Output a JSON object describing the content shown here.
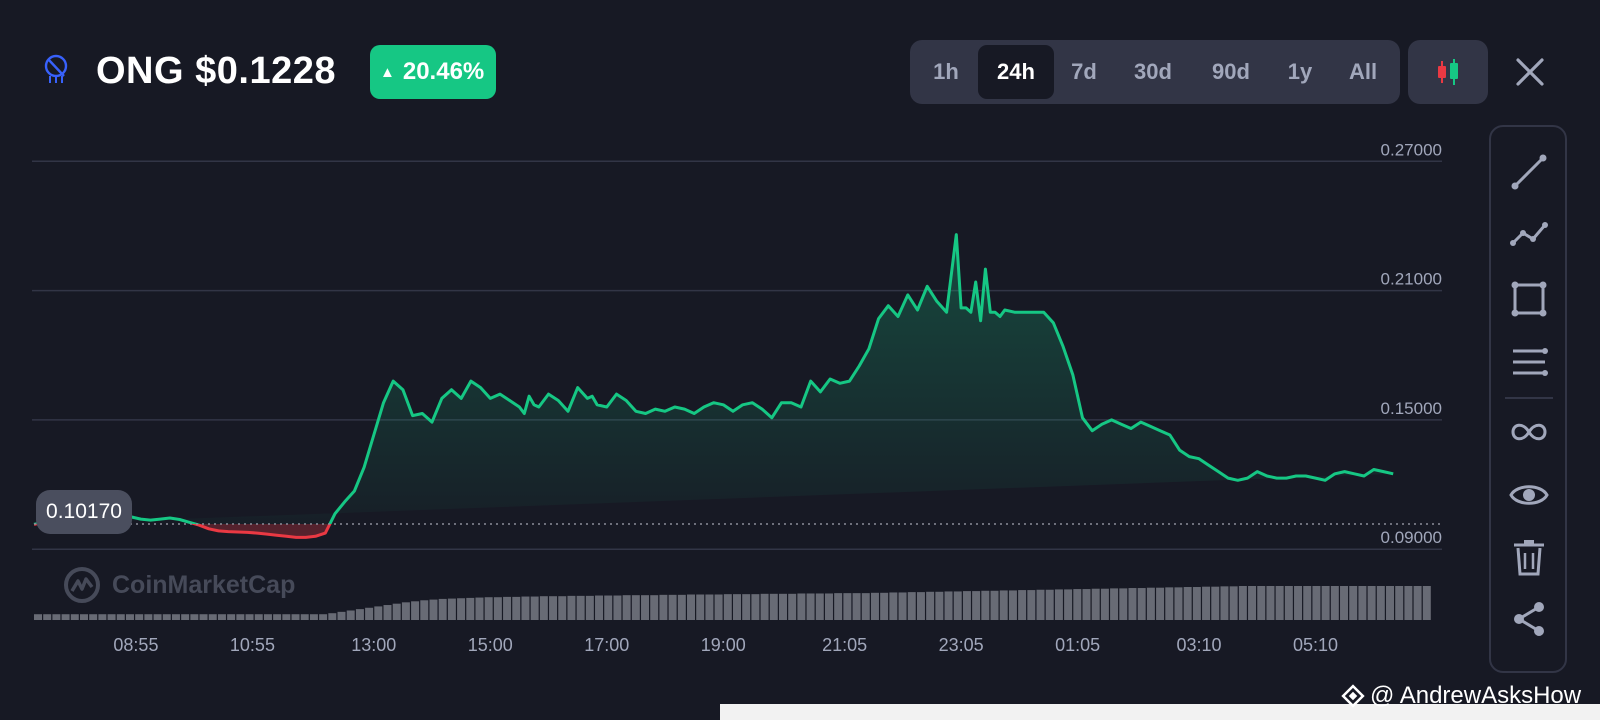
{
  "header": {
    "coin_symbol": "ONG",
    "price": "$0.1228",
    "change": "20.46%",
    "icon": "ontology-gas-icon"
  },
  "ranges": [
    {
      "label": "1h",
      "active": false
    },
    {
      "label": "24h",
      "active": true
    },
    {
      "label": "7d",
      "active": false
    },
    {
      "label": "30d",
      "active": false
    },
    {
      "label": "90d",
      "active": false
    },
    {
      "label": "1y",
      "active": false
    },
    {
      "label": "All",
      "active": false
    }
  ],
  "tools": [
    "line-tool-icon",
    "polyline-tool-icon",
    "rectangle-tool-icon",
    "horizontal-lines-tool-icon",
    "infinity-icon",
    "eye-icon",
    "trash-icon",
    "share-icon"
  ],
  "watermark": "CoinMarketCap",
  "credit": "@ AndrewAsksHow",
  "colors": {
    "up": "#16c784",
    "down": "#ea3943",
    "background": "#171924",
    "grid": "#323546",
    "axis_text": "#a1a7bb"
  },
  "chart_data": {
    "type": "line",
    "title": "",
    "xlabel": "",
    "ylabel": "",
    "reference_price": 0.1017,
    "reference_label": "0.10170",
    "ylim": [
      0.085,
      0.272
    ],
    "y_ticks": [
      0.27,
      0.21,
      0.15,
      0.09
    ],
    "y_tick_labels": [
      "0.27000",
      "0.21000",
      "0.15000",
      "0.09000"
    ],
    "x_tick_labels": [
      "08:55",
      "10:55",
      "13:00",
      "15:00",
      "17:00",
      "19:00",
      "21:05",
      "23:05",
      "01:05",
      "03:10",
      "05:10"
    ],
    "x_range_minutes": [
      0,
      1440
    ],
    "x_tick_minutes": [
      105,
      225,
      350,
      470,
      590,
      710,
      835,
      955,
      1075,
      1200,
      1320
    ],
    "grid": "horizontal",
    "series": [
      {
        "x_minutes": [
          0,
          10,
          20,
          30,
          40,
          50,
          60,
          70,
          80,
          90,
          100,
          110,
          120,
          130,
          140,
          150,
          160,
          170,
          180,
          190,
          200,
          210,
          220,
          230,
          240,
          250,
          260,
          270,
          280,
          290,
          300,
          310,
          320,
          330,
          340,
          350,
          360,
          370,
          380,
          390,
          400,
          410,
          420,
          430,
          440,
          450,
          460,
          470,
          480,
          490,
          500,
          505,
          510,
          515,
          520,
          530,
          540,
          550,
          560,
          570,
          575,
          580,
          590,
          600,
          610,
          620,
          630,
          640,
          650,
          660,
          670,
          680,
          690,
          700,
          710,
          720,
          730,
          740,
          750,
          760,
          770,
          780,
          790,
          800,
          810,
          820,
          830,
          840,
          850,
          860,
          870,
          880,
          890,
          900,
          910,
          920,
          930,
          940,
          950,
          955,
          960,
          965,
          970,
          975,
          980,
          985,
          990,
          995,
          1000,
          1010,
          1020,
          1030,
          1040,
          1050,
          1060,
          1070,
          1080,
          1090,
          1100,
          1110,
          1120,
          1130,
          1140,
          1150,
          1160,
          1170,
          1180,
          1190,
          1200,
          1210,
          1220,
          1230,
          1240,
          1250,
          1260,
          1270,
          1280,
          1290,
          1300,
          1310,
          1320,
          1330,
          1340,
          1350,
          1360,
          1370,
          1380,
          1390,
          1400,
          1410,
          1420,
          1430
        ],
        "values": [
          0.1015,
          0.1025,
          0.1035,
          0.103,
          0.1025,
          0.1022,
          0.1018,
          0.1015,
          0.103,
          0.1055,
          0.105,
          0.104,
          0.1035,
          0.104,
          0.1045,
          0.1038,
          0.1025,
          0.1012,
          0.0995,
          0.0985,
          0.0982,
          0.098,
          0.0978,
          0.0975,
          0.097,
          0.0965,
          0.096,
          0.0955,
          0.0955,
          0.096,
          0.0975,
          0.1065,
          0.112,
          0.117,
          0.128,
          0.143,
          0.158,
          0.168,
          0.164,
          0.152,
          0.153,
          0.149,
          0.16,
          0.164,
          0.16,
          0.168,
          0.165,
          0.16,
          0.162,
          0.159,
          0.156,
          0.153,
          0.161,
          0.157,
          0.156,
          0.162,
          0.159,
          0.154,
          0.165,
          0.16,
          0.161,
          0.157,
          0.156,
          0.162,
          0.159,
          0.154,
          0.153,
          0.155,
          0.154,
          0.156,
          0.155,
          0.153,
          0.156,
          0.158,
          0.157,
          0.154,
          0.157,
          0.158,
          0.155,
          0.151,
          0.158,
          0.158,
          0.156,
          0.168,
          0.163,
          0.169,
          0.167,
          0.168,
          0.175,
          0.183,
          0.197,
          0.203,
          0.198,
          0.208,
          0.201,
          0.212,
          0.205,
          0.2,
          0.236,
          0.202,
          0.202,
          0.2,
          0.214,
          0.196,
          0.22,
          0.2,
          0.2,
          0.198,
          0.201,
          0.2,
          0.2,
          0.2,
          0.2,
          0.195,
          0.184,
          0.171,
          0.151,
          0.145,
          0.148,
          0.15,
          0.148,
          0.146,
          0.149,
          0.147,
          0.145,
          0.143,
          0.136,
          0.133,
          0.132,
          0.129,
          0.126,
          0.123,
          0.122,
          0.123,
          0.126,
          0.124,
          0.123,
          0.123,
          0.124,
          0.124,
          0.123,
          0.122,
          0.125,
          0.126,
          0.125,
          0.124,
          0.127,
          0.126,
          0.125
        ],
        "volume": [
          0.17,
          0.17,
          0.17,
          0.17,
          0.17,
          0.17,
          0.17,
          0.17,
          0.17,
          0.17,
          0.17,
          0.17,
          0.17,
          0.17,
          0.17,
          0.17,
          0.17,
          0.17,
          0.17,
          0.17,
          0.17,
          0.17,
          0.17,
          0.17,
          0.17,
          0.17,
          0.17,
          0.17,
          0.17,
          0.17,
          0.17,
          0.17,
          0.2,
          0.24,
          0.28,
          0.32,
          0.36,
          0.4,
          0.44,
          0.48,
          0.52,
          0.55,
          0.58,
          0.6,
          0.62,
          0.63,
          0.64,
          0.65,
          0.66,
          0.67,
          0.67,
          0.68,
          0.68,
          0.69,
          0.69,
          0.7,
          0.7,
          0.7,
          0.71,
          0.71,
          0.71,
          0.72,
          0.72,
          0.72,
          0.73,
          0.73,
          0.73,
          0.73,
          0.74,
          0.74,
          0.74,
          0.75,
          0.75,
          0.75,
          0.75,
          0.76,
          0.76,
          0.76,
          0.76,
          0.77,
          0.77,
          0.77,
          0.77,
          0.78,
          0.78,
          0.78,
          0.78,
          0.79,
          0.79,
          0.79,
          0.79,
          0.8,
          0.8,
          0.81,
          0.81,
          0.82,
          0.82,
          0.83,
          0.83,
          0.84,
          0.84,
          0.85,
          0.85,
          0.86,
          0.86,
          0.87,
          0.87,
          0.88,
          0.88,
          0.89,
          0.89,
          0.9,
          0.9,
          0.91,
          0.91,
          0.92,
          0.92,
          0.93,
          0.93,
          0.94,
          0.94,
          0.95,
          0.95,
          0.96,
          0.96,
          0.97,
          0.97,
          0.98,
          0.98,
          0.99,
          0.99,
          1,
          1,
          1,
          1,
          1,
          1,
          1,
          1,
          1,
          1,
          1,
          1,
          1,
          1,
          1,
          1,
          1,
          1,
          1,
          1,
          1
        ]
      }
    ]
  }
}
